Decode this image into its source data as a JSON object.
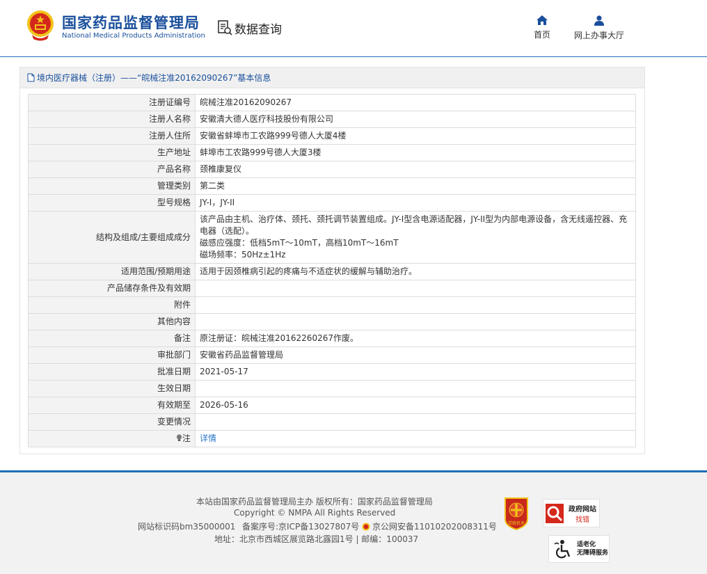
{
  "header": {
    "title_cn": "国家药品监督管理局",
    "title_en": "National Medical Products Administration",
    "query_label": "数据查询",
    "nav": {
      "home": "首页",
      "online_hall": "网上办事大厅"
    }
  },
  "panel": {
    "breadcrumb": "境内医疗器械（注册）——“皖械注准20162090267”基本信息"
  },
  "table_rows": [
    {
      "label": "注册证编号",
      "value": "皖械注准20162090267"
    },
    {
      "label": "注册人名称",
      "value": "安徽清大德人医疗科技股份有限公司"
    },
    {
      "label": "注册人住所",
      "value": "安徽省蚌埠市工农路999号德人大厦4楼"
    },
    {
      "label": "生产地址",
      "value": "蚌埠市工农路999号德人大厦3楼"
    },
    {
      "label": "产品名称",
      "value": "颈椎康复仪"
    },
    {
      "label": "管理类别",
      "value": "第二类"
    },
    {
      "label": "型号规格",
      "value": "JY-I，JY-II"
    },
    {
      "label": "结构及组成/主要组成成分",
      "value_lines": [
        "该产品由主机、治疗体、颈托、颈托调节装置组成。JY-I型含电源适配器，JY-II型为内部电源设备，含无线遥控器、充电器（选配）。",
        "磁感应强度：低档5mT～10mT，高档10mT～16mT",
        "磁场频率：50Hz±1Hz"
      ]
    },
    {
      "label": "适用范围/预期用途",
      "value": "适用于因颈椎病引起的疼痛与不适症状的缓解与辅助治疗。"
    },
    {
      "label": "产品储存条件及有效期",
      "value": ""
    },
    {
      "label": "附件",
      "value": ""
    },
    {
      "label": "其他内容",
      "value": ""
    },
    {
      "label": "备注",
      "value": "原注册证：皖械注准20162260267作废。"
    },
    {
      "label": "审批部门",
      "value": "安徽省药品监督管理局"
    },
    {
      "label": "批准日期",
      "value": "2021-05-17"
    },
    {
      "label": "生效日期",
      "value": ""
    },
    {
      "label": "有效期至",
      "value": "2026-05-16"
    },
    {
      "label": "变更情况",
      "value": ""
    },
    {
      "label": "注",
      "value": "详情"
    }
  ],
  "footer": {
    "line1": "本站由国家药品监督管理局主办 版权所有：国家药品监督管理局",
    "line2": "Copyright © NMPA All Rights Reserved",
    "site_id": "网站标识码bm35000001",
    "icp": "备案序号:京ICP备13027807号",
    "police": "京公网安备11010202008311号",
    "address": "地址：北京市西城区展览路北露园1号 | 邮编：100037",
    "badge_party": "党政机关",
    "badge_error_1": "政府网站",
    "badge_error_2": "找错",
    "badge_aged_1": "适老化",
    "badge_aged_2": "无障碍服务"
  },
  "icons": {
    "logo": "national-emblem-icon",
    "query": "data-query-icon",
    "home": "home-icon",
    "hall": "user-icon",
    "breadcrumb": "document-icon",
    "note": "lightbulb-icon",
    "police": "police-emblem-icon",
    "accessibility": "wheelchair-icon"
  },
  "colors": {
    "brand_blue": "#1a4f9c",
    "header_border": "#1f6fb8",
    "link": "#2a77c9",
    "label_bg": "#f3f3f3",
    "emblem_red": "#d4281c",
    "emblem_gold": "#f2c218"
  }
}
